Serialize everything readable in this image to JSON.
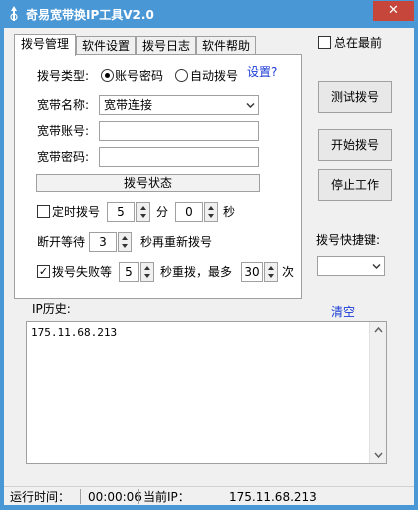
{
  "window": {
    "title": "奇易宽带换IP工具V2.0",
    "close_glyph": "✕"
  },
  "tabs": [
    {
      "label": "拨号管理",
      "active": true
    },
    {
      "label": "软件设置",
      "active": false
    },
    {
      "label": "拨号日志",
      "active": false
    },
    {
      "label": "软件帮助",
      "active": false
    }
  ],
  "topmost": {
    "label": "总在最前",
    "checked": false
  },
  "dial": {
    "type_label": "拨号类型:",
    "type_account": "账号密码",
    "type_auto": "自动拨号",
    "settings_link": "设置?",
    "name_label": "宽带名称:",
    "name_value": "宽带连接",
    "account_label": "宽带账号:",
    "account_value": "",
    "password_label": "宽带密码:",
    "password_value": "",
    "status_button": "拨号状态"
  },
  "timer": {
    "label": "定时拨号",
    "checked": false,
    "minutes": "5",
    "minutes_unit": "分",
    "seconds": "0",
    "seconds_unit": "秒"
  },
  "wait": {
    "label_before": "断开等待",
    "value": "3",
    "label_after": "秒再重新拨号"
  },
  "retry": {
    "label": "拨号失败等",
    "checked": true,
    "wait_value": "5",
    "mid_label": "秒重拨，最多",
    "max_value": "30",
    "unit": "次"
  },
  "buttons": {
    "test": "测试拨号",
    "start": "开始拨号",
    "stop": "停止工作"
  },
  "hotkey": {
    "label": "拨号快捷键:",
    "value": ""
  },
  "history": {
    "label": "IP历史:",
    "clear_link": "清空",
    "entries": [
      "175.11.68.213"
    ]
  },
  "statusbar": {
    "runtime_label": "运行时间：",
    "runtime_value": "00:00:06",
    "ip_label": "当前IP：",
    "ip_value": "175.11.68.213"
  },
  "colors": {
    "titlebar": "#4a97d6",
    "close": "#c7463b",
    "link": "#1a3bd6"
  }
}
